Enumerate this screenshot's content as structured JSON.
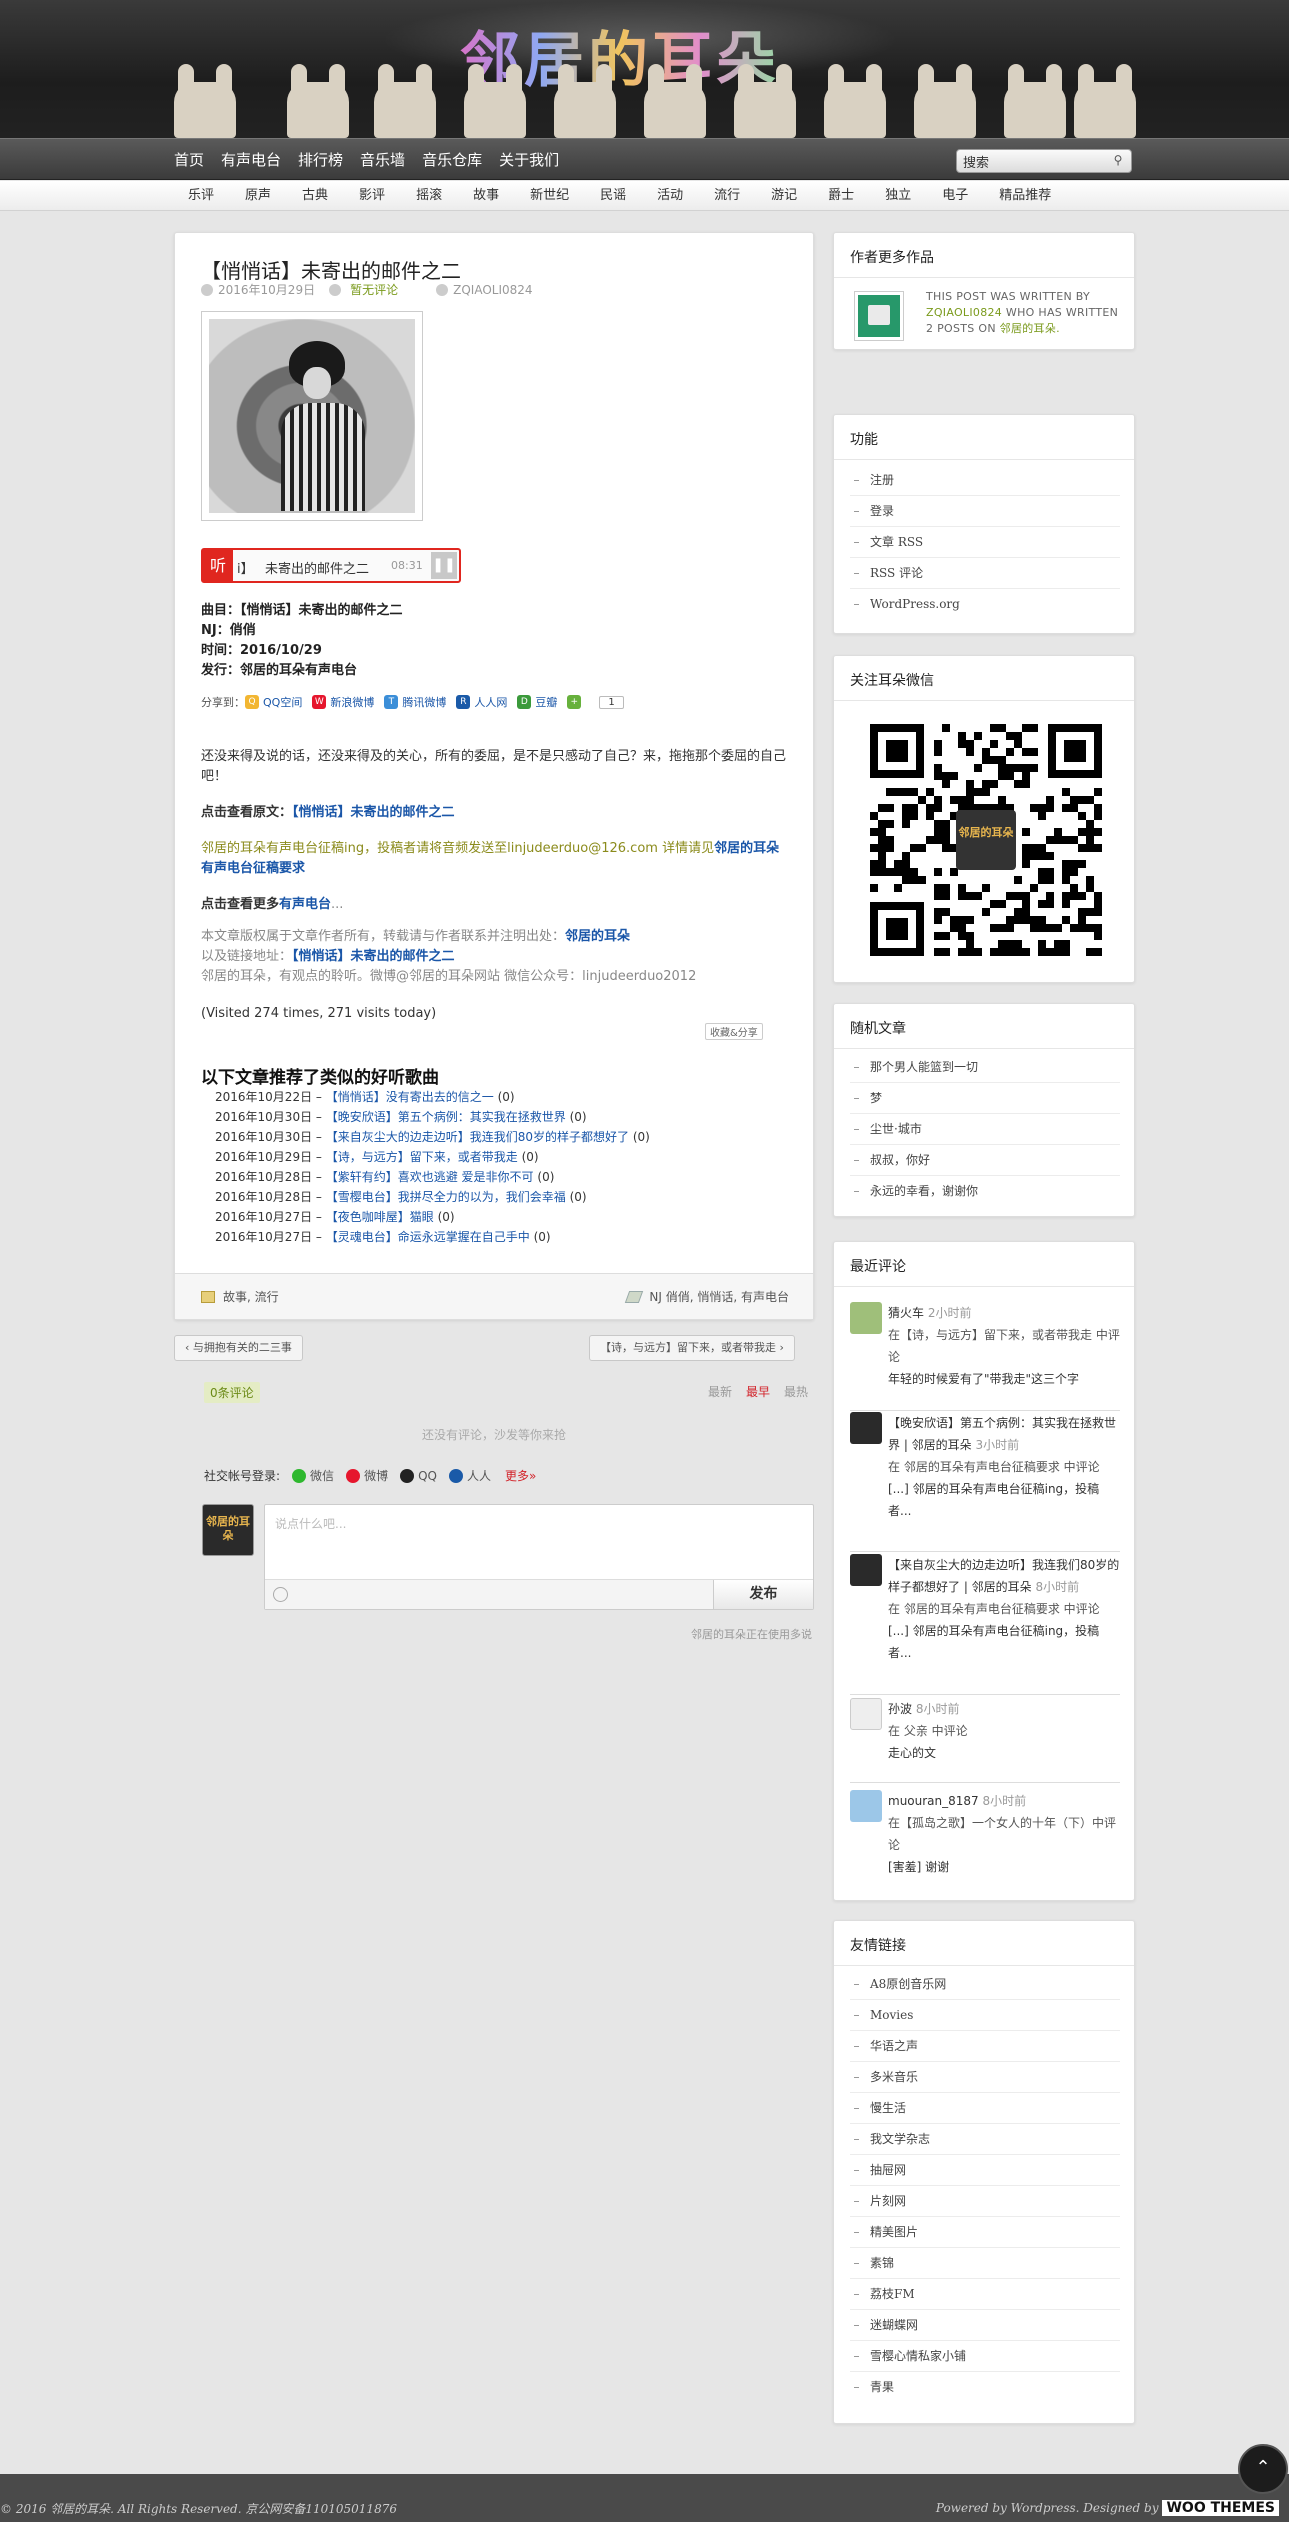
{
  "header": {
    "logo": "邻居的耳朵"
  },
  "nav": {
    "items": [
      "首页",
      "有声电台",
      "排行榜",
      "音乐墙",
      "音乐仓库",
      "关于我们"
    ],
    "search_value": "搜索"
  },
  "categories": [
    "乐评",
    "原声",
    "古典",
    "影评",
    "摇滚",
    "故事",
    "新世纪",
    "民谣",
    "活动",
    "流行",
    "游记",
    "爵士",
    "独立",
    "电子",
    "精品推荐"
  ],
  "post": {
    "title": "【悄悄话】未寄出的邮件之二",
    "date": "2016年10月29日",
    "comments_link": "暂无评论",
    "author": "ZQIAOLI0824",
    "player": {
      "logo": "听",
      "num": "i】",
      "title": "未寄出的邮件之二",
      "time": "08:31"
    },
    "song_info": [
      "曲目：【悄悄话】未寄出的邮件之二",
      "NJ：俏俏",
      "时间：2016/10/29",
      "发行：邻居的耳朵有声电台"
    ],
    "share": {
      "label": "分享到：",
      "items": [
        "QQ空间",
        "新浪微博",
        "腾讯微博",
        "人人网",
        "豆瓣"
      ],
      "count": "1"
    },
    "intro": "还没来得及说的话，还没来得及的关心，所有的委屈，是不是只感动了自己？来，拖拖那个委屈的自己吧！",
    "view_original_label": "点击查看原文：",
    "view_original_link": "【悄悄话】未寄出的邮件之二",
    "call_text": "邻居的耳朵有声电台征稿ing，投稿者请将音频发送至linjudeerduo@126.com 详情请见",
    "call_link": "邻居的耳朵有声电台征稿要求",
    "more_label": "点击查看更多",
    "more_link": "有声电台",
    "more_ellipsis": "...",
    "copyright_1": "本文章版权属于文章作者所有，转载请与作者联系并注明出处：",
    "copyright_1_link": "邻居的耳朵",
    "copyright_2": "以及链接地址：",
    "copyright_2_link": "【悄悄话】未寄出的邮件之二",
    "copyright_3": "邻居的耳朵，有观点的聆听。微博@邻居的耳朵网站 微信公众号：linjudeerduo2012",
    "visited": "(Visited 274 times, 271 visits today)",
    "fav": "收藏&分享",
    "related_title": "以下文章推荐了类似的好听歌曲",
    "related": [
      {
        "date": "2016年10月22日 –",
        "title": "【悄悄话】没有寄出去的信之一",
        "count": "(0)"
      },
      {
        "date": "2016年10月30日 –",
        "title": "【晚安欣语】第五个病例：其实我在拯救世界",
        "count": "(0)"
      },
      {
        "date": "2016年10月30日 –",
        "title": "【来自灰尘大的边走边听】我连我们80岁的样子都想好了",
        "count": "(0)"
      },
      {
        "date": "2016年10月29日 –",
        "title": "【诗，与远方】留下来，或者带我走",
        "count": "(0)"
      },
      {
        "date": "2016年10月28日 –",
        "title": "【紫轩有约】喜欢也逃避 爱是非你不可",
        "count": "(0)"
      },
      {
        "date": "2016年10月28日 –",
        "title": "【雪樱电台】我拼尽全力的以为，我们会幸福",
        "count": "(0)"
      },
      {
        "date": "2016年10月27日 –",
        "title": "【夜色咖啡屋】猫眼",
        "count": "(0)"
      },
      {
        "date": "2016年10月27日 –",
        "title": "【灵魂电台】命运永远掌握在自己手中",
        "count": "(0)"
      }
    ],
    "footer_cats": "故事, 流行",
    "footer_tags": "NJ 俏俏, 悄悄话, 有声电台"
  },
  "post_nav": {
    "prev": "‹ 与拥抱有关的二三事",
    "next": "【诗，与远方】留下来，或者带我走 ›"
  },
  "comments": {
    "count": "0条评论",
    "sort": [
      "最新",
      "最早",
      "最热"
    ],
    "empty": "还没有评论，沙发等你来抢",
    "social_label": "社交帐号登录:",
    "social": [
      "微信",
      "微博",
      "QQ",
      "人人"
    ],
    "more": "更多»",
    "avatar_text": "邻居的耳朵",
    "placeholder": "说点什么吧...",
    "submit": "发布",
    "powered": "邻居的耳朵正在使用多说"
  },
  "sidebar": {
    "author_widget": {
      "title": "作者更多作品",
      "text_1": "THIS POST WAS WRITTEN BY",
      "author": "ZQIAOLI0824",
      "text_2": "WHO HAS WRITTEN 2 POSTS ON",
      "site": "邻居的耳朵."
    },
    "functions": {
      "title": "功能",
      "items": [
        "注册",
        "登录",
        "文章 RSS",
        "RSS 评论",
        "WordPress.org"
      ]
    },
    "wechat": {
      "title": "关注耳朵微信",
      "qr_center": "邻居的耳朵"
    },
    "random": {
      "title": "随机文章",
      "items": [
        "那个男人能篮到一切",
        "梦",
        "尘世·城市",
        "叔叔，你好",
        "永远的幸看，谢谢你"
      ]
    },
    "recent_comments": {
      "title": "最近评论",
      "items": [
        {
          "name": "猜火车",
          "time": "2小时前",
          "line": "在【诗，与远方】留下来，或者带我走 中评论",
          "text": "年轻的时候爱有了\"带我走\"这三个字"
        },
        {
          "name": "【晚安欣语】第五个病例：其实我在拯救世界 | 邻居的耳朵",
          "time": "3小时前",
          "line": "在 邻居的耳朵有声电台征稿要求 中评论",
          "text": "[...] 邻居的耳朵有声电台征稿ing，投稿者..."
        },
        {
          "name": "【来自灰尘大的边走边听】我连我们80岁的样子都想好了 | 邻居的耳朵",
          "time": "8小时前",
          "line": "在 邻居的耳朵有声电台征稿要求 中评论",
          "text": "[...] 邻居的耳朵有声电台征稿ing，投稿者..."
        },
        {
          "name": "孙波",
          "time": "8小时前",
          "line": "在 父亲 中评论",
          "text": "走心的文"
        },
        {
          "name": "muouran_8187",
          "time": "8小时前",
          "line": "在【孤岛之歌】一个女人的十年（下）中评论",
          "text": "[害羞] 谢谢"
        }
      ]
    },
    "links": {
      "title": "友情链接",
      "items": [
        "A8原创音乐网",
        "Movies",
        "华语之声",
        "多米音乐",
        "慢生活",
        "我文学杂志",
        "抽屉网",
        "片刻网",
        "精美图片",
        "素锦",
        "荔枝FM",
        "迷蝴蝶网",
        "雪樱心情私家小铺",
        "青果"
      ]
    }
  },
  "footer": {
    "left": "© 2016 邻居的耳朵. All Rights Reserved. 京公网安备110105011876",
    "right": "Powered by Wordpress. Designed by",
    "woo": "WOO THEMES"
  }
}
